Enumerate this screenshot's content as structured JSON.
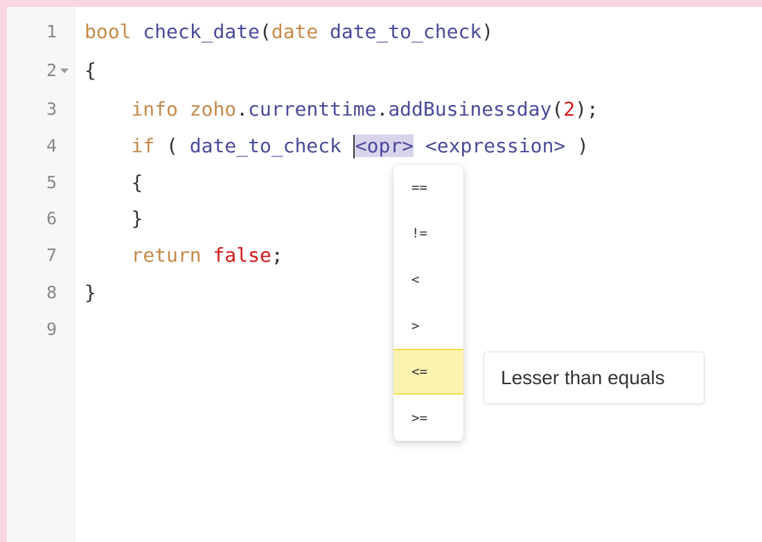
{
  "editor": {
    "line_numbers": [
      "1",
      "2",
      "3",
      "4",
      "5",
      "6",
      "7",
      "8",
      "9"
    ],
    "lines": {
      "l1": {
        "type": "bool",
        "space": " ",
        "name": "check_date",
        "open": "(",
        "ptype": "date",
        "space2": " ",
        "param": "date_to_check",
        "close": ")"
      },
      "l2": {
        "brace": "{"
      },
      "l3": {
        "indent": "    ",
        "kw": "info",
        "space": " ",
        "obj": "zoho",
        "dot": ".",
        "prop": "currenttime",
        "dot2": ".",
        "method": "addBusinessday",
        "open": "(",
        "num": "2",
        "close": ")",
        "semi": ";"
      },
      "l4": {
        "indent": "    ",
        "kw": "if",
        "open": " ( ",
        "var": "date_to_check",
        "space": " ",
        "opr": "<opr>",
        "space2": " ",
        "expr": "<expression>",
        "close": " )"
      },
      "l5": {
        "indent": "    ",
        "brace": "{"
      },
      "l6": {
        "indent": "    ",
        "brace": "}"
      },
      "l7": {
        "indent": "    ",
        "kw": "return",
        "space": " ",
        "val": "false",
        "semi": ";"
      },
      "l8": {
        "brace": "}"
      }
    }
  },
  "autocomplete": {
    "items": [
      "==",
      "!=",
      "<",
      ">",
      "<=",
      ">="
    ],
    "selected_index": 4,
    "tooltip": "Lesser than equals"
  },
  "colors": {
    "keyword": "#c58a4a",
    "identifier": "#4a4a9a",
    "number": "#d11a1a",
    "selection": "#d8d4ec",
    "highlight": "#fbf3b0",
    "frame": "#f9d6e4"
  }
}
